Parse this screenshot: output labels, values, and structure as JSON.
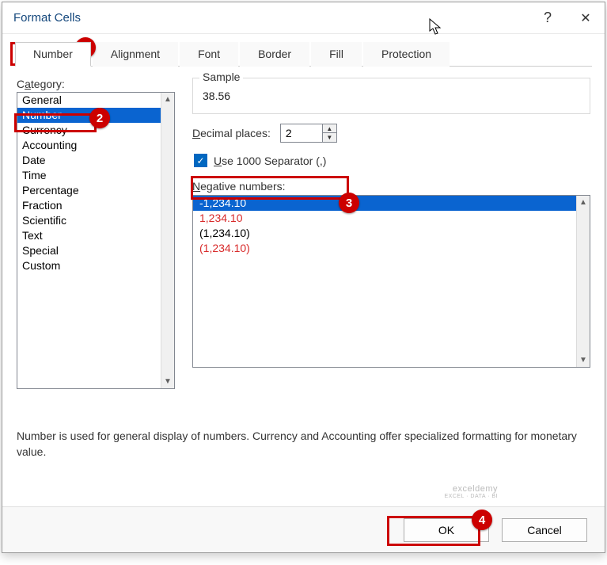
{
  "window": {
    "title": "Format Cells"
  },
  "tabs": {
    "items": [
      "Number",
      "Alignment",
      "Font",
      "Border",
      "Fill",
      "Protection"
    ],
    "active_index": 0
  },
  "category": {
    "label_pre": "C",
    "label_u": "a",
    "label_post": "tegory:",
    "items": [
      "General",
      "Number",
      "Currency",
      "Accounting",
      "Date",
      "Time",
      "Percentage",
      "Fraction",
      "Scientific",
      "Text",
      "Special",
      "Custom"
    ],
    "selected_index": 1
  },
  "sample": {
    "label": "Sample",
    "value": "38.56"
  },
  "decimal": {
    "label_u": "D",
    "label_post": "ecimal places:",
    "value": "2"
  },
  "separator": {
    "checked": true,
    "label_u": "U",
    "label_post": "se 1000 Separator (,)"
  },
  "negative": {
    "label_u": "N",
    "label_post": "egative numbers:",
    "items": [
      {
        "text": "-1,234.10",
        "sel": true,
        "red": false
      },
      {
        "text": "1,234.10",
        "sel": false,
        "red": true
      },
      {
        "text": "(1,234.10)",
        "sel": false,
        "red": false
      },
      {
        "text": "(1,234.10)",
        "sel": false,
        "red": true
      }
    ]
  },
  "description": "Number is used for general display of numbers.  Currency and Accounting offer specialized formatting for monetary value.",
  "buttons": {
    "ok": "OK",
    "cancel": "Cancel"
  },
  "watermark": {
    "l1": "exceldemy",
    "l2": "EXCEL · DATA · BI"
  },
  "callouts": {
    "c1": "1",
    "c2": "2",
    "c3": "3",
    "c4": "4"
  }
}
